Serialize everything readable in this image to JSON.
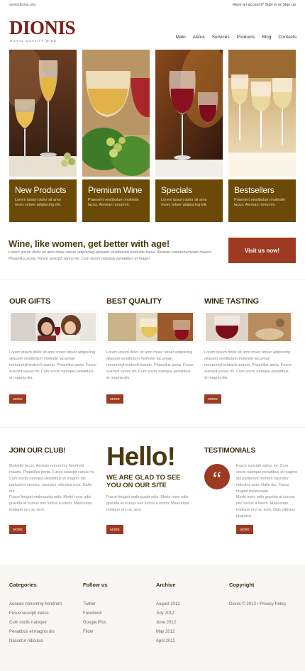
{
  "topbar": {
    "site": "www.dionis.org",
    "account_prefix": "Have an account? ",
    "account_link": "Sign in or Sign up"
  },
  "header": {
    "logo": "DIONIS",
    "tagline": "ROYAL QUALITY WINE"
  },
  "nav": [
    "Main",
    "About",
    "Services",
    "Products",
    "Blog",
    "Contacts"
  ],
  "banners": [
    {
      "title": "New Products",
      "text": "Lorem ipsum dolor sit amo moec tetuer adipiscing elit."
    },
    {
      "title": "Premium Wine",
      "text": "Praesent vestibulum molestie lacus. Aenean nonumm."
    },
    {
      "title": "Specials",
      "text": "Lorem ipsum dolor sit amo moec tetuer adipiscing elit."
    },
    {
      "title": "Bestsellers",
      "text": "Praesent vestibulum molestie lacus. Aenean nonumm."
    }
  ],
  "slogan": {
    "title": "Wine, like women, get better with age!",
    "text": "Lorem ipsum dolor sit amo moec tetuer adipiscing aliquam vestibulum molestie lacus. Aenean nonummyhendr mauris. Phasellus porta. Fusce suscipit varius mi. Cum sociis natoque penatibus et magni.",
    "button": "Visit us now!"
  },
  "features": [
    {
      "title": "OUR GIFTS",
      "text": "Lorem ipsum dolor sit amo moec tetuer adipiscing aliquam vestibulum molestie lacuenan nonummyhendrerit mauris. Phasellus porta. Fusce suscipit varius mi. Cum sociis natoque penatibus et magnis dis.",
      "more": "MORE"
    },
    {
      "title": "BEST QUALITY",
      "text": "Lorem ipsum dolor sit amo moec tetuer adipiscing aliquam vestibulum molestie lacuenan nonummyhendrerit mauris. Phasellus porta. Fusce suscipit varius mi. Cum sociis natoque penatibus et magnis dis.",
      "more": "MORE"
    },
    {
      "title": "WINE TASTING",
      "text": "Lorem ipsum dolor sit amo moec tetuer adipiscing aliquam vestibulum molestie lacuenan nonummyhendrerit mauris. Phasellus porta. Fusce suscipit varius mi. Cum sociis natoque penatibus et magnis dis.",
      "more": "MORE"
    }
  ],
  "club": {
    "title": "JOIN OUR CLUB!",
    "text1": "Molestie lacus. Aenean nonummy hendrerit mauris. Phasellus porta. Fusce suscipit varius mi. Cum sociis natoque penatibus et magnis dis parturient montes, nascetur ridiculus mus. Nulla dui.",
    "text2": "Fusce feugiat malesuada odio. Morbi nunc odio gravida at cursus nec luctus a lorem. Maecenas tristique orci ac sem.",
    "more": "MORE"
  },
  "hello": {
    "title": "Hello!",
    "subtitle": "WE ARE GLAD TO SEE YOU ON OUR SITE",
    "text1": "Lorem ipsum dolor sit amo moec tetuer adipiscing elit. Molestie lacus. Aenean nonummy hendrerit mauris. Phasellus porta. Fusce suscipit varius mi. Cum sociis natoque penatibus et magnis dis.",
    "text2": "Fusce feugiat malesuada odio. Morbi nunc odio gravida at cursus nec luctus a lorem. Maecenas tristique orci ac sem.",
    "more": "MORE"
  },
  "testimonials": {
    "title": "TESTIMONIALS",
    "quote_mark": "“",
    "text1": "Fusce suscipit varius mi. Cum sociis natoque penatibus et magnis dis parturient montes nascetur ridiculus mus. Nulla dui. Fusce feugiat malesuada.",
    "text2": "Morbi nunc odio gravida at cursus nec luctus a lorem. Maecenas tristique orci ac sem. Duis ultricies pharetra.",
    "more": "MORE"
  },
  "footer": {
    "categories": {
      "title": "Categories",
      "links": [
        "Aenean nonummy hendrerit",
        "Fusce suscipit varius",
        "Cum sociis natoque",
        "Penatibus et magnis dis",
        "Nascetur ridiculus"
      ]
    },
    "follow": {
      "title": "Follow us",
      "links": [
        "Twitter",
        "Facebook",
        "Google Plus",
        "Flickr"
      ]
    },
    "archive": {
      "title": "Archive",
      "links": [
        "August 2012",
        "July 2012",
        "June 2012",
        "May 2012",
        "April 2012"
      ]
    },
    "copyright": {
      "title": "Copyright",
      "text": "Dionis © 2013 • Privacy Policy"
    }
  }
}
